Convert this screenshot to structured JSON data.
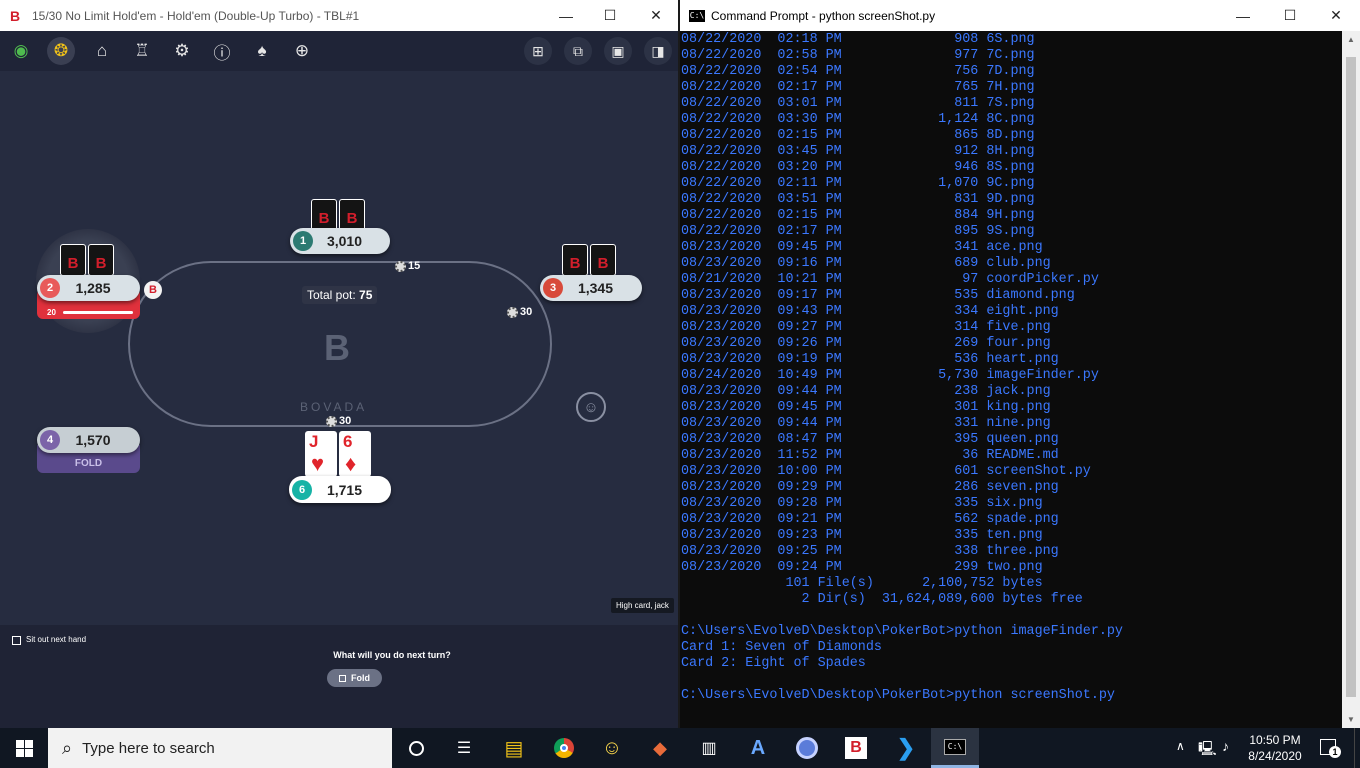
{
  "poker": {
    "title": "15/30 No Limit Hold'em - Hold'em (Double-Up Turbo) - TBL#1",
    "logo_letter": "B",
    "brand": "BOVADA",
    "total_pot_label": "Total pot:",
    "total_pot": "75",
    "seats": [
      {
        "number": "1",
        "stack": "3,010",
        "color": "#2c7a72"
      },
      {
        "number": "2",
        "stack": "1,285",
        "color": "#e85a5a",
        "timer": "20"
      },
      {
        "number": "3",
        "stack": "1,345",
        "color": "#d84a3a"
      },
      {
        "number": "4",
        "stack": "1,570",
        "color": "#7b63a8",
        "status": "FOLD"
      },
      {
        "number": "6",
        "stack": "1,715",
        "color": "#16b3a6"
      }
    ],
    "bets": {
      "seat1": "15",
      "seat3": "30",
      "seat6": "30"
    },
    "dealer_button": "B",
    "hero_cards": [
      {
        "rank": "J",
        "suit": "♥"
      },
      {
        "rank": "6",
        "suit": "♦"
      }
    ],
    "hand_rank": "High card, jack",
    "sit_out_label": "Sit out next hand",
    "prompt": "What will you do next turn?",
    "fold_button": "Fold",
    "card_back_letter": "B"
  },
  "cmd": {
    "title": "Command Prompt - python  screenShot.py",
    "listing": [
      {
        "date": "08/22/2020",
        "time": "02:18 PM",
        "size": "908",
        "name": "6S.png"
      },
      {
        "date": "08/22/2020",
        "time": "02:58 PM",
        "size": "977",
        "name": "7C.png"
      },
      {
        "date": "08/22/2020",
        "time": "02:54 PM",
        "size": "756",
        "name": "7D.png"
      },
      {
        "date": "08/22/2020",
        "time": "02:17 PM",
        "size": "765",
        "name": "7H.png"
      },
      {
        "date": "08/22/2020",
        "time": "03:01 PM",
        "size": "811",
        "name": "7S.png"
      },
      {
        "date": "08/22/2020",
        "time": "03:30 PM",
        "size": "1,124",
        "name": "8C.png"
      },
      {
        "date": "08/22/2020",
        "time": "02:15 PM",
        "size": "865",
        "name": "8D.png"
      },
      {
        "date": "08/22/2020",
        "time": "03:45 PM",
        "size": "912",
        "name": "8H.png"
      },
      {
        "date": "08/22/2020",
        "time": "03:20 PM",
        "size": "946",
        "name": "8S.png"
      },
      {
        "date": "08/22/2020",
        "time": "02:11 PM",
        "size": "1,070",
        "name": "9C.png"
      },
      {
        "date": "08/22/2020",
        "time": "03:51 PM",
        "size": "831",
        "name": "9D.png"
      },
      {
        "date": "08/22/2020",
        "time": "02:15 PM",
        "size": "884",
        "name": "9H.png"
      },
      {
        "date": "08/22/2020",
        "time": "02:17 PM",
        "size": "895",
        "name": "9S.png"
      },
      {
        "date": "08/23/2020",
        "time": "09:45 PM",
        "size": "341",
        "name": "ace.png"
      },
      {
        "date": "08/23/2020",
        "time": "09:16 PM",
        "size": "689",
        "name": "club.png"
      },
      {
        "date": "08/21/2020",
        "time": "10:21 PM",
        "size": "97",
        "name": "coordPicker.py"
      },
      {
        "date": "08/23/2020",
        "time": "09:17 PM",
        "size": "535",
        "name": "diamond.png"
      },
      {
        "date": "08/23/2020",
        "time": "09:43 PM",
        "size": "334",
        "name": "eight.png"
      },
      {
        "date": "08/23/2020",
        "time": "09:27 PM",
        "size": "314",
        "name": "five.png"
      },
      {
        "date": "08/23/2020",
        "time": "09:26 PM",
        "size": "269",
        "name": "four.png"
      },
      {
        "date": "08/23/2020",
        "time": "09:19 PM",
        "size": "536",
        "name": "heart.png"
      },
      {
        "date": "08/24/2020",
        "time": "10:49 PM",
        "size": "5,730",
        "name": "imageFinder.py"
      },
      {
        "date": "08/23/2020",
        "time": "09:44 PM",
        "size": "238",
        "name": "jack.png"
      },
      {
        "date": "08/23/2020",
        "time": "09:45 PM",
        "size": "301",
        "name": "king.png"
      },
      {
        "date": "08/23/2020",
        "time": "09:44 PM",
        "size": "331",
        "name": "nine.png"
      },
      {
        "date": "08/23/2020",
        "time": "08:47 PM",
        "size": "395",
        "name": "queen.png"
      },
      {
        "date": "08/23/2020",
        "time": "11:52 PM",
        "size": "36",
        "name": "README.md"
      },
      {
        "date": "08/23/2020",
        "time": "10:00 PM",
        "size": "601",
        "name": "screenShot.py"
      },
      {
        "date": "08/23/2020",
        "time": "09:29 PM",
        "size": "286",
        "name": "seven.png"
      },
      {
        "date": "08/23/2020",
        "time": "09:28 PM",
        "size": "335",
        "name": "six.png"
      },
      {
        "date": "08/23/2020",
        "time": "09:21 PM",
        "size": "562",
        "name": "spade.png"
      },
      {
        "date": "08/23/2020",
        "time": "09:23 PM",
        "size": "335",
        "name": "ten.png"
      },
      {
        "date": "08/23/2020",
        "time": "09:25 PM",
        "size": "338",
        "name": "three.png"
      },
      {
        "date": "08/23/2020",
        "time": "09:24 PM",
        "size": "299",
        "name": "two.png"
      }
    ],
    "summary_files": "             101 File(s)      2,100,752 bytes",
    "summary_dirs": "               2 Dir(s)  31,624,089,600 bytes free",
    "prompt1": "C:\\Users\\EvolveD\\Desktop\\PokerBot>python imageFinder.py",
    "out1": "Card 1: Seven of Diamonds",
    "out2": "Card 2: Eight of Spades",
    "prompt2": "C:\\Users\\EvolveD\\Desktop\\PokerBot>python screenShot.py"
  },
  "taskbar": {
    "search_placeholder": "Type here to search",
    "time": "10:50 PM",
    "date": "8/24/2020",
    "notification_count": "1"
  }
}
